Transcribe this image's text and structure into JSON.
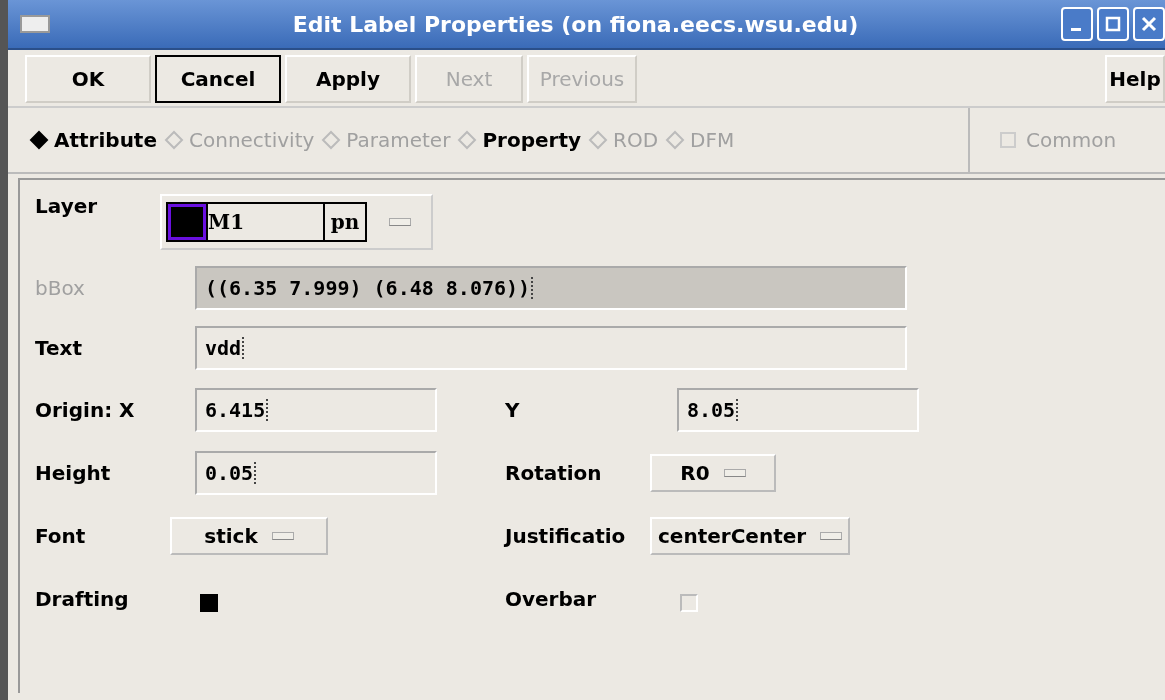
{
  "window": {
    "title": "Edit Label Properties (on fiona.eecs.wsu.edu)"
  },
  "buttons": [
    {
      "label": "OK",
      "disabled": false,
      "focused": false
    },
    {
      "label": "Cancel",
      "disabled": false,
      "focused": true
    },
    {
      "label": "Apply",
      "disabled": false,
      "focused": false
    },
    {
      "label": "Next",
      "disabled": true,
      "focused": false
    },
    {
      "label": "Previous",
      "disabled": true,
      "focused": false
    }
  ],
  "help_button": {
    "label": "Help"
  },
  "modes": [
    {
      "label": "Attribute",
      "selected": true,
      "disabled": false
    },
    {
      "label": "Connectivity",
      "selected": false,
      "disabled": true
    },
    {
      "label": "Parameter",
      "selected": false,
      "disabled": true
    },
    {
      "label": "Property",
      "selected": false,
      "disabled": false
    },
    {
      "label": "ROD",
      "selected": false,
      "disabled": true
    },
    {
      "label": "DFM",
      "selected": false,
      "disabled": true
    }
  ],
  "common": {
    "label": "Common",
    "checked": false,
    "disabled": true
  },
  "layer": {
    "label": "Layer",
    "color": "#000000",
    "name": "M1",
    "purpose": "pn"
  },
  "wide_fields": [
    {
      "label": "bBox",
      "value": "((6.35 7.999) (6.48 8.076))",
      "disabled": true
    },
    {
      "label": "Text",
      "value": "vdd",
      "disabled": false
    }
  ],
  "rows": [
    {
      "left": {
        "kind": "text",
        "label": "Origin:  X",
        "value": "6.415"
      },
      "right": {
        "kind": "text",
        "label": "Y",
        "value": "8.05"
      }
    },
    {
      "left": {
        "kind": "text",
        "label": "Height",
        "value": "0.05"
      },
      "right": {
        "kind": "select",
        "label": "Rotation",
        "value": "R0"
      }
    },
    {
      "left": {
        "kind": "select",
        "label": "Font",
        "value": "stick"
      },
      "right": {
        "kind": "select",
        "label": "Justificatio",
        "value": "centerCenter"
      }
    },
    {
      "left": {
        "kind": "check",
        "label": "Drafting",
        "checked": true
      },
      "right": {
        "kind": "check",
        "label": "Overbar",
        "checked": false
      }
    }
  ]
}
